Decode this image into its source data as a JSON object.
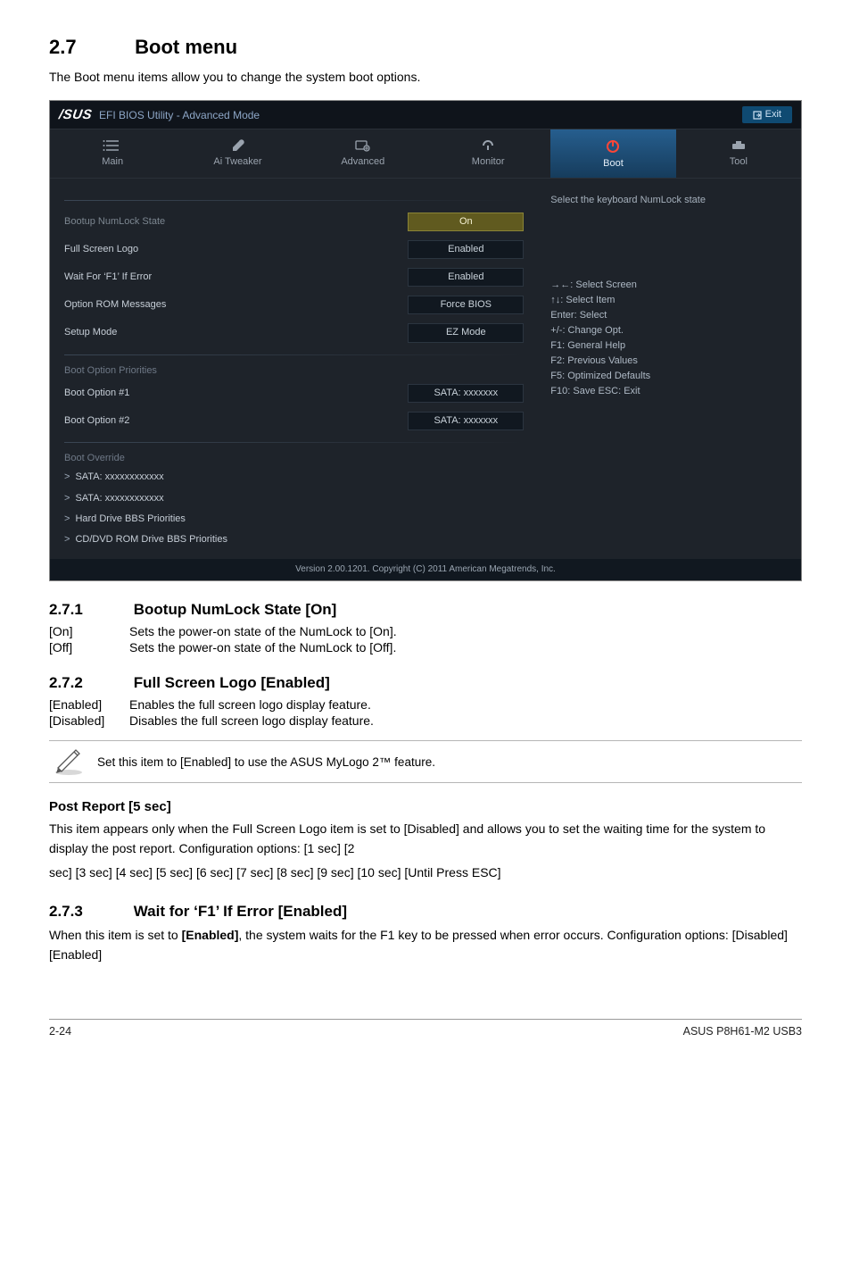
{
  "section": {
    "num": "2.7",
    "title": "Boot menu",
    "intro": "The Boot menu items allow you to change the system boot options."
  },
  "bios": {
    "brand": "/SUS",
    "title": "EFI BIOS Utility - Advanced Mode",
    "exit": "Exit",
    "tabs": {
      "main": "Main",
      "ai": "Ai  Tweaker",
      "adv": "Advanced",
      "mon": "Monitor",
      "boot": "Boot",
      "tool": "Tool"
    },
    "rows": {
      "numlock": {
        "label": "Bootup NumLock State",
        "value": "On"
      },
      "logo": {
        "label": "Full Screen Logo",
        "value": "Enabled"
      },
      "waitf1": {
        "label": "Wait For ‘F1’ If Error",
        "value": "Enabled"
      },
      "optrom": {
        "label": "Option ROM Messages",
        "value": "Force BIOS"
      },
      "setupmode": {
        "label": "Setup Mode",
        "value": "EZ Mode"
      }
    },
    "bootprio": {
      "header": "Boot Option Priorities",
      "opt1": "Boot Option #1",
      "v1": "SATA: xxxxxxx",
      "opt2": "Boot Option #2",
      "v2": "SATA: xxxxxxx"
    },
    "override": {
      "header": "Boot Override",
      "sata1": "SATA: xxxxxxxxxxxx",
      "sata2": "SATA: xxxxxxxxxxxx",
      "hdd": "Hard Drive BBS Priorities",
      "cd": "CD/DVD ROM Drive BBS Priorities"
    },
    "help": "Select the keyboard NumLock state",
    "keys": {
      "k1": "→←:  Select Screen",
      "k2": "↑↓:  Select Item",
      "k3": "Enter:  Select",
      "k4": "+/-:  Change Opt.",
      "k5": "F1:  General Help",
      "k6": "F2:  Previous Values",
      "k7": "F5:  Optimized Defaults",
      "k8": "F10:  Save   ESC:  Exit"
    },
    "footer": "Version  2.00.1201.   Copyright  (C)  2011 American  Megatrends,  Inc."
  },
  "s271": {
    "num": "2.7.1",
    "title": "Bootup NumLock State [On]",
    "on_k": "[On]",
    "on_v": "Sets the power-on state of the NumLock to [On].",
    "off_k": "[Off]",
    "off_v": "Sets the power-on state of the NumLock to [Off]."
  },
  "s272": {
    "num": "2.7.2",
    "title": "Full Screen Logo [Enabled]",
    "en_k": "[Enabled]",
    "en_v": "Enables the full screen logo display feature.",
    "di_k": "[Disabled]",
    "di_v": "Disables the full screen logo display feature."
  },
  "note": "Set this item to [Enabled] to use the ASUS MyLogo 2™ feature.",
  "post": {
    "title": "Post Report [5 sec]",
    "p1": "This item appears only when the Full Screen Logo item is set to [Disabled] and allows you to set the waiting time for the system to display the post report. Configuration options: [1 sec] [2",
    "p2": "sec] [3 sec] [4 sec] [5 sec] [6 sec] [7 sec] [8 sec] [9 sec] [10 sec] [Until Press ESC]"
  },
  "s273": {
    "num": "2.7.3",
    "title": "Wait for ‘F1’ If Error [Enabled]",
    "body_pre": "When this item is set to ",
    "body_bold": "[Enabled]",
    "body_post": ", the system waits for the F1 key to be pressed when error occurs. Configuration options: [Disabled] [Enabled]"
  },
  "footer": {
    "page": "2-24",
    "product": "ASUS P8H61-M2 USB3"
  }
}
